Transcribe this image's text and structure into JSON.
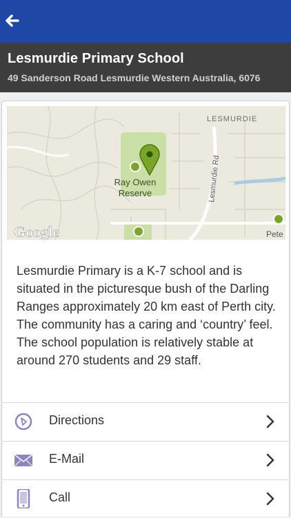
{
  "header": {
    "title": "Lesmurdie Primary School",
    "address": "49 Sanderson Road Lesmurdie Western Australia, 6076"
  },
  "map": {
    "labels": {
      "suburb": "LESMURDIE",
      "road": "Lesmurdie Rd",
      "park_line1": "Ray Owen",
      "park_line2": "Reserve",
      "partial": "Pete",
      "provider": "Google"
    },
    "colors": {
      "pin": "#7aa628",
      "park": "#c9dfa6",
      "water": "#a7cde3",
      "road": "#ffffff"
    }
  },
  "description": "Lesmurdie Primary is a K-7 school and is situated in the picturesque bush of the Darling Ranges approximately 20 km east of Perth city. The community has a caring and ‘country’ feel. The school population is relatively stable at around 270 students and 29 staff.",
  "actions": [
    {
      "label": "Directions",
      "icon": "compass-icon"
    },
    {
      "label": "E-Mail",
      "icon": "envelope-icon"
    },
    {
      "label": "Call",
      "icon": "phone-icon"
    }
  ],
  "colors": {
    "topbar": "#1f47a6",
    "header": "#3d3d3d",
    "icon_accent": "#8a84c7"
  }
}
